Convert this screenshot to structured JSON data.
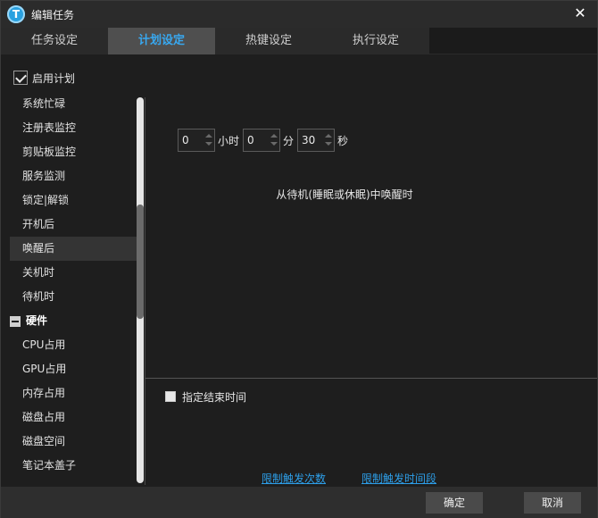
{
  "window": {
    "title": "编辑任务",
    "app_icon_letter": "T",
    "close_symbol": "✕",
    "accent_color": "#38a8f0"
  },
  "tabs": [
    {
      "label": "任务设定",
      "active": false
    },
    {
      "label": "计划设定",
      "active": true
    },
    {
      "label": "热键设定",
      "active": false
    },
    {
      "label": "执行设定",
      "active": false
    }
  ],
  "schedule": {
    "enable_label": "启用计划",
    "enabled": true,
    "items": [
      {
        "label": "系统忙碌"
      },
      {
        "label": "注册表监控"
      },
      {
        "label": "剪贴板监控"
      },
      {
        "label": "服务监测"
      },
      {
        "label": "锁定|解锁"
      },
      {
        "label": "开机后"
      },
      {
        "label": "唤醒后",
        "active": true
      },
      {
        "label": "关机时"
      },
      {
        "label": "待机时"
      }
    ],
    "group": {
      "label": "硬件",
      "expanded": true
    },
    "group_items": [
      {
        "label": "CPU占用"
      },
      {
        "label": "GPU占用"
      },
      {
        "label": "内存占用"
      },
      {
        "label": "磁盘占用"
      },
      {
        "label": "磁盘空间"
      },
      {
        "label": "笔记本盖子"
      }
    ]
  },
  "delay": {
    "hours_value": "0",
    "hours_unit": "小时",
    "minutes_value": "0",
    "minutes_unit": "分",
    "seconds_value": "30",
    "seconds_unit": "秒"
  },
  "description": "从待机(睡眠或休眠)中唤醒时",
  "end_time": {
    "label": "指定结束时间",
    "checked": false
  },
  "links": {
    "limit_count": "限制触发次数",
    "limit_period": "限制触发时间段"
  },
  "buttons": {
    "ok": "确定",
    "cancel": "取消"
  }
}
